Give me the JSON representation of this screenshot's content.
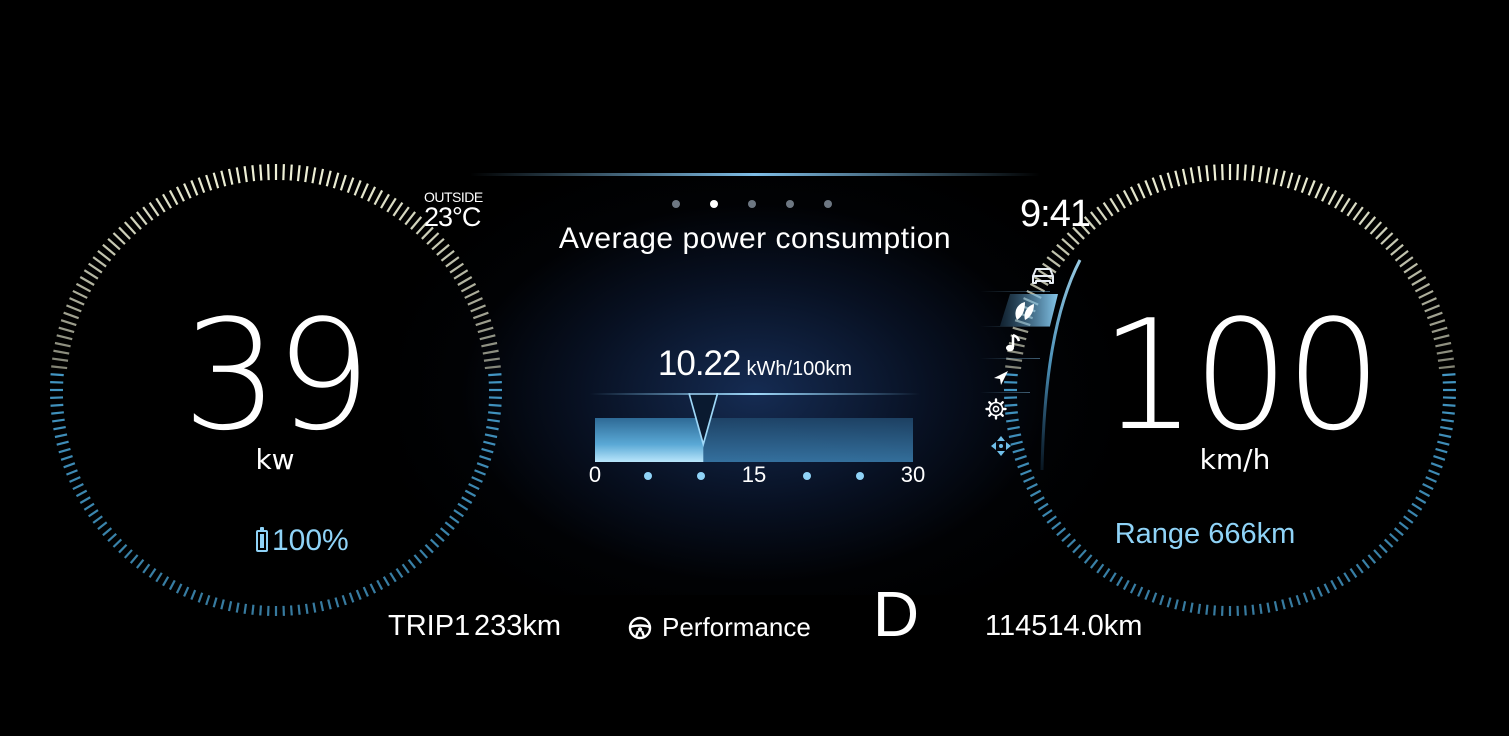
{
  "outside": {
    "label": "OUTSIDE",
    "temperature": "23°C"
  },
  "clock": "9:41",
  "panel": {
    "title": "Average power consumption",
    "page_count": 5,
    "active_page": 1
  },
  "power": {
    "value": "39",
    "unit": "kw"
  },
  "battery": {
    "percent_text": "100%",
    "level": 1.0
  },
  "speed": {
    "value": "100",
    "unit": "km/h"
  },
  "range": {
    "text": "Range 666km"
  },
  "consumption": {
    "value": "10.22",
    "unit": "kWh/100km",
    "scale_min": 0,
    "scale_max": 30,
    "current": 10.22,
    "tick_labels": [
      {
        "value": 0,
        "text": "0"
      },
      {
        "value": 15,
        "text": "15"
      },
      {
        "value": 30,
        "text": "30"
      }
    ],
    "tick_dots": [
      5,
      10,
      20,
      25
    ]
  },
  "side_menu": {
    "items": [
      {
        "name": "vehicle",
        "icon": "car-icon",
        "active": false
      },
      {
        "name": "eco",
        "icon": "leaf-icon",
        "active": true
      },
      {
        "name": "media",
        "icon": "music-note-icon",
        "active": false
      },
      {
        "name": "navigation",
        "icon": "navigation-arrow-icon",
        "active": false
      },
      {
        "name": "settings",
        "icon": "gear-icon",
        "active": false
      },
      {
        "name": "adjust",
        "icon": "four-way-arrows-icon",
        "active": false
      }
    ]
  },
  "bottom": {
    "trip_label": "TRIP1",
    "trip_value": "233km",
    "drive_mode": "Performance",
    "drive_mode_icon": "steering-wheel-icon",
    "gear": "D",
    "odometer": "114514.0km"
  },
  "colors": {
    "accent": "#8fd3f7",
    "gauge_tick_outer": "#eef0d6",
    "gauge_tick_inner": "#4aa6d8",
    "background": "#000000"
  }
}
